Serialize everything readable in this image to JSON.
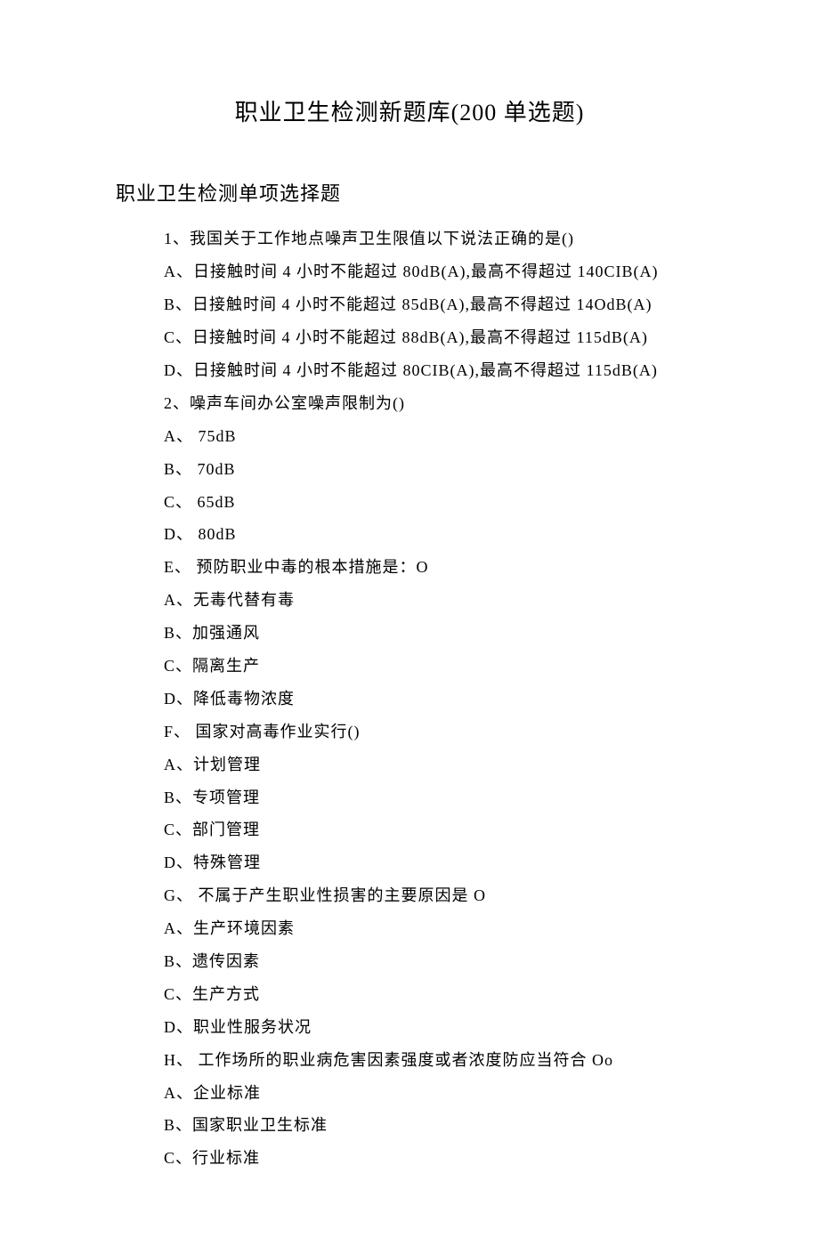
{
  "title": "职业卫生检测新题库(200 单选题)",
  "section_heading": "职业卫生检测单项选择题",
  "lines": [
    "1、我国关于工作地点噪声卫生限值以下说法正确的是()",
    "A、日接触时间 4 小时不能超过 80dB(A),最高不得超过 140CIB(A)",
    "B、日接触时间 4 小时不能超过 85dB(A),最高不得超过 14OdB(A)",
    "C、日接触时间 4 小时不能超过 88dB(A),最高不得超过 115dB(A)",
    "D、日接触时间 4 小时不能超过 80CIB(A),最高不得超过 115dB(A)",
    "2、噪声车间办公室噪声限制为()",
    "A、 75dB",
    "B、 70dB",
    "C、 65dB",
    "D、 80dB",
    "E、 预防职业中毒的根本措施是：O",
    "A、无毒代替有毒",
    "B、加强通风",
    "C、隔离生产",
    "D、降低毒物浓度",
    "F、 国家对高毒作业实行()",
    "A、计划管理",
    "B、专项管理",
    "C、部门管理",
    "D、特殊管理",
    "G、 不属于产生职业性损害的主要原因是 O",
    "A、生产环境因素",
    "B、遗传因素",
    "C、生产方式",
    "D、职业性服务状况",
    "H、 工作场所的职业病危害因素强度或者浓度防应当符合 Oo",
    "A、企业标准",
    "B、国家职业卫生标准",
    "C、行业标准"
  ]
}
